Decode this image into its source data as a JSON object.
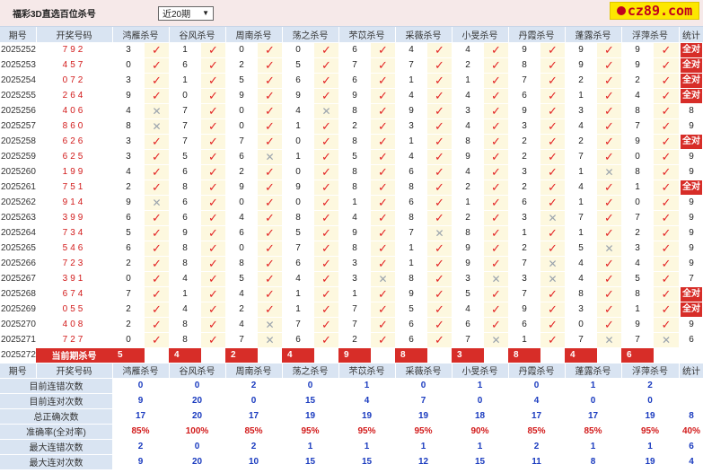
{
  "header": {
    "title": "福彩3D直选百位杀号",
    "period_select": "近20期",
    "logo_text": "cz89.com"
  },
  "columns": {
    "issue": "期号",
    "code": "开奖号码",
    "kills": [
      "鸿雁杀号",
      "谷风杀号",
      "周南杀号",
      "荡之杀号",
      "芣苡杀号",
      "采薇杀号",
      "小旻杀号",
      "丹霞杀号",
      "蓬露杀号",
      "浮萍杀号"
    ],
    "stat": "统计"
  },
  "rows": [
    {
      "issue": "2025252",
      "code": "792",
      "kills": [
        {
          "n": "3",
          "ok": true
        },
        {
          "n": "1",
          "ok": true
        },
        {
          "n": "0",
          "ok": true
        },
        {
          "n": "0",
          "ok": true
        },
        {
          "n": "6",
          "ok": true
        },
        {
          "n": "4",
          "ok": true
        },
        {
          "n": "4",
          "ok": true
        },
        {
          "n": "9",
          "ok": true
        },
        {
          "n": "9",
          "ok": true
        },
        {
          "n": "9",
          "ok": true
        }
      ],
      "stat": "全对"
    },
    {
      "issue": "2025253",
      "code": "457",
      "kills": [
        {
          "n": "0",
          "ok": true
        },
        {
          "n": "6",
          "ok": true
        },
        {
          "n": "2",
          "ok": true
        },
        {
          "n": "5",
          "ok": true
        },
        {
          "n": "7",
          "ok": true
        },
        {
          "n": "7",
          "ok": true
        },
        {
          "n": "2",
          "ok": true
        },
        {
          "n": "8",
          "ok": true
        },
        {
          "n": "9",
          "ok": true
        },
        {
          "n": "9",
          "ok": true
        }
      ],
      "stat": "全对"
    },
    {
      "issue": "2025254",
      "code": "072",
      "kills": [
        {
          "n": "3",
          "ok": true
        },
        {
          "n": "1",
          "ok": true
        },
        {
          "n": "5",
          "ok": true
        },
        {
          "n": "6",
          "ok": true
        },
        {
          "n": "6",
          "ok": true
        },
        {
          "n": "1",
          "ok": true
        },
        {
          "n": "1",
          "ok": true
        },
        {
          "n": "7",
          "ok": true
        },
        {
          "n": "2",
          "ok": true
        },
        {
          "n": "2",
          "ok": true
        }
      ],
      "stat": "全对"
    },
    {
      "issue": "2025255",
      "code": "264",
      "kills": [
        {
          "n": "9",
          "ok": true
        },
        {
          "n": "0",
          "ok": true
        },
        {
          "n": "9",
          "ok": true
        },
        {
          "n": "9",
          "ok": true
        },
        {
          "n": "9",
          "ok": true
        },
        {
          "n": "4",
          "ok": true
        },
        {
          "n": "4",
          "ok": true
        },
        {
          "n": "6",
          "ok": true
        },
        {
          "n": "1",
          "ok": true
        },
        {
          "n": "4",
          "ok": true
        }
      ],
      "stat": "全对"
    },
    {
      "issue": "2025256",
      "code": "406",
      "kills": [
        {
          "n": "4",
          "ok": false
        },
        {
          "n": "7",
          "ok": true
        },
        {
          "n": "0",
          "ok": true
        },
        {
          "n": "4",
          "ok": false
        },
        {
          "n": "8",
          "ok": true
        },
        {
          "n": "9",
          "ok": true
        },
        {
          "n": "3",
          "ok": true
        },
        {
          "n": "9",
          "ok": true
        },
        {
          "n": "3",
          "ok": true
        },
        {
          "n": "8",
          "ok": true
        }
      ],
      "stat": "8"
    },
    {
      "issue": "2025257",
      "code": "860",
      "kills": [
        {
          "n": "8",
          "ok": false
        },
        {
          "n": "7",
          "ok": true
        },
        {
          "n": "0",
          "ok": true
        },
        {
          "n": "1",
          "ok": true
        },
        {
          "n": "2",
          "ok": true
        },
        {
          "n": "3",
          "ok": true
        },
        {
          "n": "4",
          "ok": true
        },
        {
          "n": "3",
          "ok": true
        },
        {
          "n": "4",
          "ok": true
        },
        {
          "n": "7",
          "ok": true
        }
      ],
      "stat": "9"
    },
    {
      "issue": "2025258",
      "code": "626",
      "kills": [
        {
          "n": "3",
          "ok": true
        },
        {
          "n": "7",
          "ok": true
        },
        {
          "n": "7",
          "ok": true
        },
        {
          "n": "0",
          "ok": true
        },
        {
          "n": "8",
          "ok": true
        },
        {
          "n": "1",
          "ok": true
        },
        {
          "n": "8",
          "ok": true
        },
        {
          "n": "2",
          "ok": true
        },
        {
          "n": "2",
          "ok": true
        },
        {
          "n": "9",
          "ok": true
        }
      ],
      "stat": "全对"
    },
    {
      "issue": "2025259",
      "code": "625",
      "kills": [
        {
          "n": "3",
          "ok": true
        },
        {
          "n": "5",
          "ok": true
        },
        {
          "n": "6",
          "ok": false
        },
        {
          "n": "1",
          "ok": true
        },
        {
          "n": "5",
          "ok": true
        },
        {
          "n": "4",
          "ok": true
        },
        {
          "n": "9",
          "ok": true
        },
        {
          "n": "2",
          "ok": true
        },
        {
          "n": "7",
          "ok": true
        },
        {
          "n": "0",
          "ok": true
        }
      ],
      "stat": "9"
    },
    {
      "issue": "2025260",
      "code": "199",
      "kills": [
        {
          "n": "4",
          "ok": true
        },
        {
          "n": "6",
          "ok": true
        },
        {
          "n": "2",
          "ok": true
        },
        {
          "n": "0",
          "ok": true
        },
        {
          "n": "8",
          "ok": true
        },
        {
          "n": "6",
          "ok": true
        },
        {
          "n": "4",
          "ok": true
        },
        {
          "n": "3",
          "ok": true
        },
        {
          "n": "1",
          "ok": false
        },
        {
          "n": "8",
          "ok": true
        }
      ],
      "stat": "9"
    },
    {
      "issue": "2025261",
      "code": "751",
      "kills": [
        {
          "n": "2",
          "ok": true
        },
        {
          "n": "8",
          "ok": true
        },
        {
          "n": "9",
          "ok": true
        },
        {
          "n": "9",
          "ok": true
        },
        {
          "n": "8",
          "ok": true
        },
        {
          "n": "8",
          "ok": true
        },
        {
          "n": "2",
          "ok": true
        },
        {
          "n": "2",
          "ok": true
        },
        {
          "n": "4",
          "ok": true
        },
        {
          "n": "1",
          "ok": true
        }
      ],
      "stat": "全对"
    },
    {
      "issue": "2025262",
      "code": "914",
      "kills": [
        {
          "n": "9",
          "ok": false
        },
        {
          "n": "6",
          "ok": true
        },
        {
          "n": "0",
          "ok": true
        },
        {
          "n": "0",
          "ok": true
        },
        {
          "n": "1",
          "ok": true
        },
        {
          "n": "6",
          "ok": true
        },
        {
          "n": "1",
          "ok": true
        },
        {
          "n": "6",
          "ok": true
        },
        {
          "n": "1",
          "ok": true
        },
        {
          "n": "0",
          "ok": true
        }
      ],
      "stat": "9"
    },
    {
      "issue": "2025263",
      "code": "399",
      "kills": [
        {
          "n": "6",
          "ok": true
        },
        {
          "n": "6",
          "ok": true
        },
        {
          "n": "4",
          "ok": true
        },
        {
          "n": "8",
          "ok": true
        },
        {
          "n": "4",
          "ok": true
        },
        {
          "n": "8",
          "ok": true
        },
        {
          "n": "2",
          "ok": true
        },
        {
          "n": "3",
          "ok": false
        },
        {
          "n": "7",
          "ok": true
        },
        {
          "n": "7",
          "ok": true
        }
      ],
      "stat": "9"
    },
    {
      "issue": "2025264",
      "code": "734",
      "kills": [
        {
          "n": "5",
          "ok": true
        },
        {
          "n": "9",
          "ok": true
        },
        {
          "n": "6",
          "ok": true
        },
        {
          "n": "5",
          "ok": true
        },
        {
          "n": "9",
          "ok": true
        },
        {
          "n": "7",
          "ok": false
        },
        {
          "n": "8",
          "ok": true
        },
        {
          "n": "1",
          "ok": true
        },
        {
          "n": "1",
          "ok": true
        },
        {
          "n": "2",
          "ok": true
        }
      ],
      "stat": "9"
    },
    {
      "issue": "2025265",
      "code": "546",
      "kills": [
        {
          "n": "6",
          "ok": true
        },
        {
          "n": "8",
          "ok": true
        },
        {
          "n": "0",
          "ok": true
        },
        {
          "n": "7",
          "ok": true
        },
        {
          "n": "8",
          "ok": true
        },
        {
          "n": "1",
          "ok": true
        },
        {
          "n": "9",
          "ok": true
        },
        {
          "n": "2",
          "ok": true
        },
        {
          "n": "5",
          "ok": false
        },
        {
          "n": "3",
          "ok": true
        }
      ],
      "stat": "9"
    },
    {
      "issue": "2025266",
      "code": "723",
      "kills": [
        {
          "n": "2",
          "ok": true
        },
        {
          "n": "8",
          "ok": true
        },
        {
          "n": "8",
          "ok": true
        },
        {
          "n": "6",
          "ok": true
        },
        {
          "n": "3",
          "ok": true
        },
        {
          "n": "1",
          "ok": true
        },
        {
          "n": "9",
          "ok": true
        },
        {
          "n": "7",
          "ok": false
        },
        {
          "n": "4",
          "ok": true
        },
        {
          "n": "4",
          "ok": true
        }
      ],
      "stat": "9"
    },
    {
      "issue": "2025267",
      "code": "391",
      "kills": [
        {
          "n": "0",
          "ok": true
        },
        {
          "n": "4",
          "ok": true
        },
        {
          "n": "5",
          "ok": true
        },
        {
          "n": "4",
          "ok": true
        },
        {
          "n": "3",
          "ok": false
        },
        {
          "n": "8",
          "ok": true
        },
        {
          "n": "3",
          "ok": false
        },
        {
          "n": "3",
          "ok": false
        },
        {
          "n": "4",
          "ok": true
        },
        {
          "n": "5",
          "ok": true
        }
      ],
      "stat": "7"
    },
    {
      "issue": "2025268",
      "code": "674",
      "kills": [
        {
          "n": "7",
          "ok": true
        },
        {
          "n": "1",
          "ok": true
        },
        {
          "n": "4",
          "ok": true
        },
        {
          "n": "1",
          "ok": true
        },
        {
          "n": "1",
          "ok": true
        },
        {
          "n": "9",
          "ok": true
        },
        {
          "n": "5",
          "ok": true
        },
        {
          "n": "7",
          "ok": true
        },
        {
          "n": "8",
          "ok": true
        },
        {
          "n": "8",
          "ok": true
        }
      ],
      "stat": "全对"
    },
    {
      "issue": "2025269",
      "code": "055",
      "kills": [
        {
          "n": "2",
          "ok": true
        },
        {
          "n": "4",
          "ok": true
        },
        {
          "n": "2",
          "ok": true
        },
        {
          "n": "1",
          "ok": true
        },
        {
          "n": "7",
          "ok": true
        },
        {
          "n": "5",
          "ok": true
        },
        {
          "n": "4",
          "ok": true
        },
        {
          "n": "9",
          "ok": true
        },
        {
          "n": "3",
          "ok": true
        },
        {
          "n": "1",
          "ok": true
        }
      ],
      "stat": "全对"
    },
    {
      "issue": "2025270",
      "code": "408",
      "kills": [
        {
          "n": "2",
          "ok": true
        },
        {
          "n": "8",
          "ok": true
        },
        {
          "n": "4",
          "ok": false
        },
        {
          "n": "7",
          "ok": true
        },
        {
          "n": "7",
          "ok": true
        },
        {
          "n": "6",
          "ok": true
        },
        {
          "n": "6",
          "ok": true
        },
        {
          "n": "6",
          "ok": true
        },
        {
          "n": "0",
          "ok": true
        },
        {
          "n": "9",
          "ok": true
        }
      ],
      "stat": "9"
    },
    {
      "issue": "2025271",
      "code": "727",
      "kills": [
        {
          "n": "0",
          "ok": true
        },
        {
          "n": "8",
          "ok": true
        },
        {
          "n": "7",
          "ok": false
        },
        {
          "n": "6",
          "ok": true
        },
        {
          "n": "2",
          "ok": true
        },
        {
          "n": "6",
          "ok": true
        },
        {
          "n": "7",
          "ok": false
        },
        {
          "n": "1",
          "ok": true
        },
        {
          "n": "7",
          "ok": false
        },
        {
          "n": "7",
          "ok": false
        }
      ],
      "stat": "6"
    }
  ],
  "current": {
    "issue": "2025272",
    "label": "当前期杀号",
    "kills": [
      "5",
      "4",
      "2",
      "4",
      "9",
      "8",
      "3",
      "8",
      "4",
      "6"
    ]
  },
  "stats": [
    {
      "label": "目前连错次数",
      "values": [
        "0",
        "0",
        "2",
        "0",
        "1",
        "0",
        "1",
        "0",
        "1",
        "2"
      ]
    },
    {
      "label": "目前连对次数",
      "values": [
        "9",
        "20",
        "0",
        "15",
        "4",
        "7",
        "0",
        "4",
        "0",
        "0"
      ]
    },
    {
      "label": "总正确次数",
      "values": [
        "17",
        "20",
        "17",
        "19",
        "19",
        "19",
        "18",
        "17",
        "17",
        "19",
        "8"
      ]
    },
    {
      "label": "准确率(全对率)",
      "values": [
        "85%",
        "100%",
        "85%",
        "95%",
        "95%",
        "95%",
        "90%",
        "85%",
        "85%",
        "95%",
        "40%"
      ],
      "red": true
    },
    {
      "label": "最大连错次数",
      "values": [
        "2",
        "0",
        "2",
        "1",
        "1",
        "1",
        "1",
        "2",
        "1",
        "1",
        "6"
      ]
    },
    {
      "label": "最大连对次数",
      "values": [
        "9",
        "20",
        "10",
        "15",
        "15",
        "12",
        "15",
        "11",
        "8",
        "19",
        "4"
      ]
    }
  ],
  "icons": {
    "ok": "check-icon",
    "fail": "cross-icon"
  },
  "colors": {
    "accent_red": "#d72d28",
    "header_blue": "#d9e4f2",
    "mark_cell": "#fdf8df",
    "stat_blue": "#1a3bbf"
  }
}
